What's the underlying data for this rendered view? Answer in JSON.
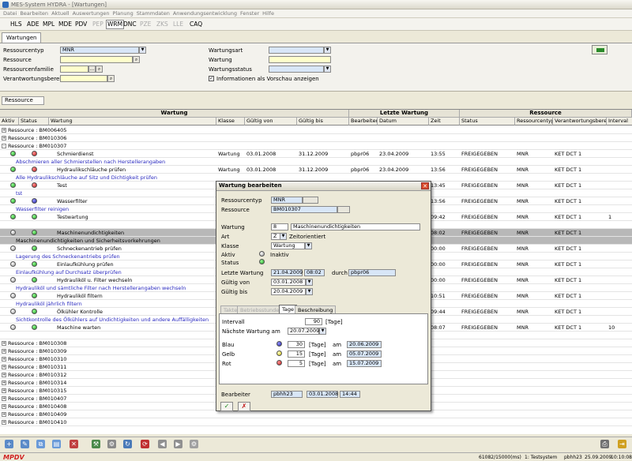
{
  "window": {
    "title": "MES-System HYDRA - [Wartungen]"
  },
  "menu": [
    "Datei",
    "Bearbeiten",
    "Aktuell",
    "Auswertungen",
    "Planung",
    "Stammdaten",
    "Anwendungsentwicklung",
    "Fenster",
    "Hilfe"
  ],
  "modules": [
    {
      "label": "HLS",
      "state": "on"
    },
    {
      "label": "ADE",
      "state": "on"
    },
    {
      "label": "MPL",
      "state": "on"
    },
    {
      "label": "MDE",
      "state": "on"
    },
    {
      "label": "PDV",
      "state": "on"
    },
    {
      "label": "PEP",
      "state": "dis"
    },
    {
      "label": "WRM",
      "state": "sel"
    },
    {
      "label": "DNC",
      "state": "on"
    },
    {
      "label": "PZE",
      "state": "dis"
    },
    {
      "label": "ZKS",
      "state": "dis"
    },
    {
      "label": "LLE",
      "state": "dis"
    },
    {
      "label": "CAQ",
      "state": "on"
    }
  ],
  "tab": "Wartungen",
  "filter": {
    "ressourcentyp_label": "Ressourcentyp",
    "ressourcentyp_value": "MNR",
    "ressource_label": "Ressource",
    "ressourcenfamilie_label": "Ressourcenfamilie",
    "verantwortungsbereich_label": "Verantwortungsbereich",
    "wartungsart_label": "Wartungsart",
    "wartung_label": "Wartung",
    "wartungsstatus_label": "Wartungsstatus",
    "vorschau_label": "Informationen als Vorschau anzeigen",
    "vorschau_checked": "✓"
  },
  "ressource_button": "Ressource",
  "grid": {
    "groups": {
      "wartung": "Wartung",
      "letzte": "Letzte Wartung",
      "ressource": "Ressource"
    },
    "columns": [
      "Aktiv",
      "Status",
      "Wartung",
      "Klasse",
      "Gültig von",
      "Gültig bis",
      "Bearbeiter",
      "Datum",
      "Zeit",
      "Status",
      "Ressourcentyp",
      "Verantwortungsbereich",
      "Interval"
    ]
  },
  "rows": [
    {
      "type": "grp",
      "sign": "+",
      "text": "Ressource : BM006405"
    },
    {
      "type": "grp",
      "sign": "+",
      "text": "Ressource : BM010306"
    },
    {
      "type": "grp",
      "sign": "-",
      "text": "Ressource : BM010307"
    },
    {
      "type": "data",
      "aktiv": "green",
      "status": "red",
      "wartung": "Schmierdienst",
      "klasse": "Wartung",
      "von": "03.01.2008",
      "bis": "31.12.2009",
      "bearb": "pbpr06",
      "datum": "23.04.2009",
      "zeit": "13:55",
      "rstatus": "FREIGEGEBEN",
      "rtyp": "MNR",
      "verant": "KET DCT 1",
      "interval": ""
    },
    {
      "type": "desc",
      "text": "Abschmieren aller Schmierstellen nach Herstellerangaben"
    },
    {
      "type": "data",
      "aktiv": "green",
      "status": "red",
      "wartung": "Hydraulikschläuche prüfen",
      "klasse": "Wartung",
      "von": "03.01.2008",
      "bis": "31.12.2009",
      "bearb": "pbpr06",
      "datum": "23.04.2009",
      "zeit": "13:56",
      "rstatus": "FREIGEGEBEN",
      "rtyp": "MNR",
      "verant": "KET DCT 1",
      "interval": ""
    },
    {
      "type": "desc",
      "text": "Alle Hydraulikschläuche auf Sitz und Dichtigkeit prüfen"
    },
    {
      "type": "data",
      "aktiv": "green",
      "status": "red",
      "wartung": "Test",
      "klasse": "",
      "von": "",
      "bis": "",
      "bearb": "",
      "datum": "",
      "zeit": "13:45",
      "rstatus": "FREIGEGEBEN",
      "rtyp": "MNR",
      "verant": "KET DCT 1",
      "interval": ""
    },
    {
      "type": "desc",
      "text": "tst"
    },
    {
      "type": "data",
      "aktiv": "green",
      "status": "blue",
      "wartung": "Wasserfilter",
      "klasse": "",
      "von": "",
      "bis": "",
      "bearb": "",
      "datum": "",
      "zeit": "13:56",
      "rstatus": "FREIGEGEBEN",
      "rtyp": "MNR",
      "verant": "KET DCT 1",
      "interval": ""
    },
    {
      "type": "desc",
      "text": "Wasserfilter reinigen"
    },
    {
      "type": "data",
      "aktiv": "green",
      "status": "green",
      "wartung": "Testwartung",
      "klasse": "",
      "von": "",
      "bis": "",
      "bearb": "",
      "datum": "",
      "zeit": "09:42",
      "rstatus": "FREIGEGEBEN",
      "rtyp": "MNR",
      "verant": "KET DCT 1",
      "interval": "1"
    },
    {
      "type": "blank"
    },
    {
      "type": "datahl",
      "aktiv": "grey",
      "status": "green",
      "wartung": "Maschinenundichtigkeiten",
      "klasse": "",
      "von": "",
      "bis": "",
      "bearb": "",
      "datum": "",
      "zeit": "08:02",
      "rstatus": "FREIGEGEBEN",
      "rtyp": "MNR",
      "verant": "KET DCT 1",
      "interval": ""
    },
    {
      "type": "deschl",
      "text": "Maschinenundichtigkeiten und Sicherheitsvorkehrungen"
    },
    {
      "type": "data",
      "aktiv": "grey",
      "status": "green",
      "wartung": "Schneckenantrieb prüfen",
      "klasse": "",
      "von": "",
      "bis": "",
      "bearb": "",
      "datum": "",
      "zeit": "00:00",
      "rstatus": "FREIGEGEBEN",
      "rtyp": "MNR",
      "verant": "KET DCT 1",
      "interval": ""
    },
    {
      "type": "desc",
      "text": "Lagerung des Schneckenantriebs prüfen"
    },
    {
      "type": "data",
      "aktiv": "grey",
      "status": "green",
      "wartung": "Einlaufkühlung prüfen",
      "klasse": "",
      "von": "",
      "bis": "",
      "bearb": "",
      "datum": "",
      "zeit": "00:00",
      "rstatus": "FREIGEGEBEN",
      "rtyp": "MNR",
      "verant": "KET DCT 1",
      "interval": ""
    },
    {
      "type": "desc",
      "text": "Einlaufkühlung auf Durchsatz überprüfen"
    },
    {
      "type": "data",
      "aktiv": "grey",
      "status": "green",
      "wartung": "Hydrauliköl u. Filter wechseln",
      "klasse": "",
      "von": "",
      "bis": "",
      "bearb": "",
      "datum": "",
      "zeit": "00:00",
      "rstatus": "FREIGEGEBEN",
      "rtyp": "MNR",
      "verant": "KET DCT 1",
      "interval": ""
    },
    {
      "type": "desc",
      "text": "Hydrauliköl und sämtliche Filter nach Herstellerangaben wechseln"
    },
    {
      "type": "data",
      "aktiv": "grey",
      "status": "green",
      "wartung": "Hydrauliköl filtern",
      "klasse": "",
      "von": "",
      "bis": "",
      "bearb": "",
      "datum": "",
      "zeit": "10:51",
      "rstatus": "FREIGEGEBEN",
      "rtyp": "MNR",
      "verant": "KET DCT 1",
      "interval": ""
    },
    {
      "type": "desc",
      "text": "Hydrauliköl jährlich filtern"
    },
    {
      "type": "data",
      "aktiv": "grey",
      "status": "green",
      "wartung": "Ölkühler Kontrolle",
      "klasse": "",
      "von": "",
      "bis": "",
      "bearb": "",
      "datum": "",
      "zeit": "09:44",
      "rstatus": "FREIGEGEBEN",
      "rtyp": "MNR",
      "verant": "KET DCT 1",
      "interval": ""
    },
    {
      "type": "desc",
      "text": "Sichtkontrolle des Ölkühlers auf Undichtigkeiten und andere Auffälligkeiten"
    },
    {
      "type": "data",
      "aktiv": "grey",
      "status": "green",
      "wartung": "Maschine warten",
      "klasse": "",
      "von": "",
      "bis": "",
      "bearb": "",
      "datum": "",
      "zeit": "08:07",
      "rstatus": "FREIGEGEBEN",
      "rtyp": "MNR",
      "verant": "KET DCT 1",
      "interval": "10"
    },
    {
      "type": "blank"
    },
    {
      "type": "grp",
      "sign": "+",
      "text": "Ressource : BM010308"
    },
    {
      "type": "grp",
      "sign": "+",
      "text": "Ressource : BM010309"
    },
    {
      "type": "grp",
      "sign": "+",
      "text": "Ressource : BM010310"
    },
    {
      "type": "grp",
      "sign": "+",
      "text": "Ressource : BM010311"
    },
    {
      "type": "grp",
      "sign": "+",
      "text": "Ressource : BM010312"
    },
    {
      "type": "grp",
      "sign": "+",
      "text": "Ressource : BM010314"
    },
    {
      "type": "grp",
      "sign": "+",
      "text": "Ressource : BM010315"
    },
    {
      "type": "grp",
      "sign": "+",
      "text": "Ressource : BM010407"
    },
    {
      "type": "grp",
      "sign": "+",
      "text": "Ressource : BM010408"
    },
    {
      "type": "grp",
      "sign": "+",
      "text": "Ressource : BM010409"
    },
    {
      "type": "grp",
      "sign": "+",
      "text": "Ressource : BM010410"
    }
  ],
  "dialog": {
    "title": "Wartung bearbeiten",
    "ressourcentyp_label": "Ressourcentyp",
    "ressourcentyp": "MNR",
    "ressource_label": "Ressource",
    "ressource": "BM010307",
    "wartung_label": "Wartung",
    "wartung_nr": "8",
    "wartung_name": "Maschinenundichtigkeiten",
    "art_label": "Art",
    "art_value": "Z",
    "art_text": "Zeitorientiert",
    "klasse_label": "Klasse",
    "klasse_value": "Wartung",
    "aktiv_label": "Aktiv",
    "aktiv_text": "Inaktiv",
    "status_label": "Status",
    "letzte_label": "Letzte Wartung",
    "letzte_datum": "21.04.2009",
    "letzte_zeit": "08:02",
    "durch_label": "durch",
    "durch_value": "pbpr06",
    "von_label": "Gültig von",
    "von_value": "03.01.2008",
    "bis_label": "Gültig bis",
    "bis_value": "20.04.2009",
    "tabs": [
      {
        "label": "Takte",
        "state": "dis"
      },
      {
        "label": "Betriebsstunden",
        "state": "dis"
      },
      {
        "label": "Tage",
        "state": "act"
      },
      {
        "label": "Beschreibung",
        "state": "on"
      }
    ],
    "interval_label": "Intervall",
    "interval_value": "90",
    "tage_unit": "[Tage]",
    "naechste_label": "Nächste Wartung am",
    "naechste_value": "20.07.2009",
    "warn": [
      {
        "label": "Blau",
        "color": "blue",
        "days": "30",
        "am": "am",
        "date": "20.06.2009"
      },
      {
        "label": "Gelb",
        "color": "yellow",
        "days": "15",
        "am": "am",
        "date": "05.07.2009"
      },
      {
        "label": "Rot",
        "color": "red",
        "days": "5",
        "am": "am",
        "date": "15.07.2009"
      }
    ],
    "bearbeiter_label": "Bearbeiter",
    "bearbeiter": "pbhh23",
    "bearbeiter_datum": "03.01.2008",
    "bearbeiter_zeit": "14:44",
    "ok": "✓",
    "cancel": "✗"
  },
  "status": {
    "logo": "MPDV",
    "mem": "61082/15000(ms)",
    "sys": "1: Testsystem",
    "user": "pbhh23",
    "date": "25.09.2009",
    "time": "10:10:08"
  }
}
